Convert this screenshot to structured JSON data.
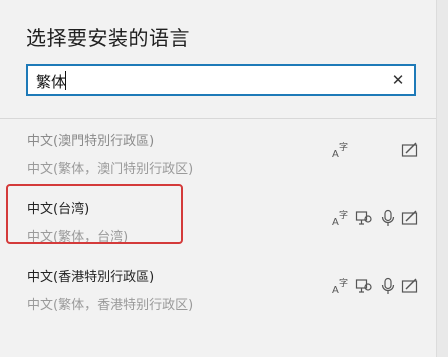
{
  "dialog": {
    "title": "选择要安装的语言",
    "search": {
      "value": "繁体",
      "clear_glyph": "✕"
    }
  },
  "languages": [
    {
      "name": "中文(澳門特別行政區)",
      "native": "中文(繁体，澳门特别行政区)",
      "features": [
        "handwriting-icon-placeholder"
      ]
    },
    {
      "name": "中文(台湾)",
      "native": "中文(繁体，台湾)"
    },
    {
      "name": "中文(香港特別行政區)",
      "native": "中文(繁体，香港特别行政区)"
    }
  ],
  "colors": {
    "accent": "#1e7ab8",
    "highlight": "#d43a3a"
  }
}
